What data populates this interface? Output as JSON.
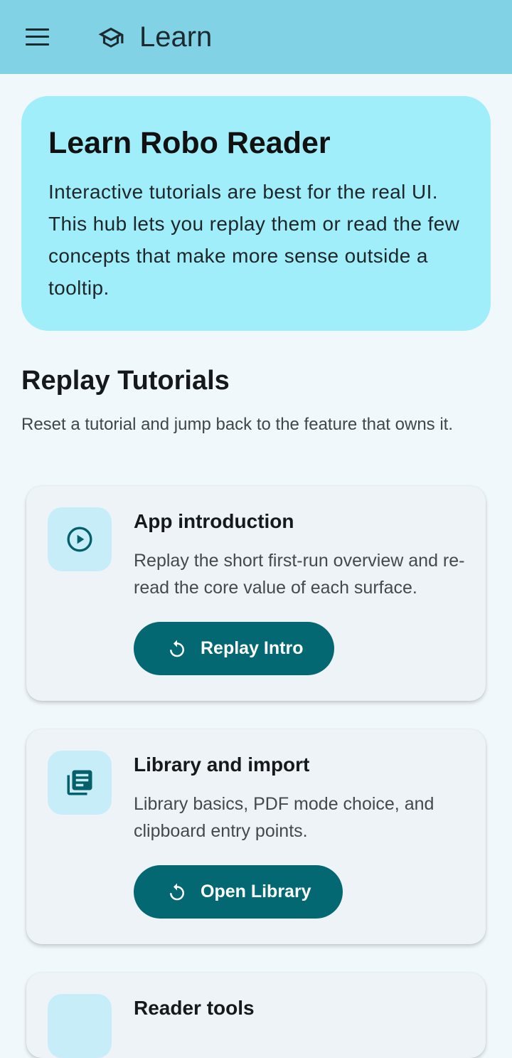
{
  "appbar": {
    "menu_icon": "hamburger-menu-icon",
    "app_icon": "graduation-cap-icon",
    "title": "Learn"
  },
  "hero": {
    "title": "Learn Robo Reader",
    "description": "Interactive tutorials are best for the real UI. This hub lets you replay them or read the few concepts that make more sense outside a tooltip."
  },
  "section": {
    "title": "Replay Tutorials",
    "subtitle": "Reset a tutorial and jump back to the feature that owns it."
  },
  "cards": [
    {
      "icon": "play-circle-icon",
      "title": "App introduction",
      "description": "Replay the short first-run overview and re-read the core value of each surface.",
      "button_icon": "replay-icon",
      "button_label": "Replay Intro"
    },
    {
      "icon": "library-books-icon",
      "title": "Library and import",
      "description": "Library basics, PDF mode choice, and clipboard entry points.",
      "button_icon": "replay-icon",
      "button_label": "Open Library"
    },
    {
      "icon": "reader-icon",
      "title": "Reader tools",
      "description": "",
      "button_label": ""
    }
  ],
  "colors": {
    "appbar": "#80d2e4",
    "hero": "#a1eefb",
    "button": "#036872",
    "icon_tile": "#c7eef8",
    "icon_stroke": "#05606b"
  }
}
